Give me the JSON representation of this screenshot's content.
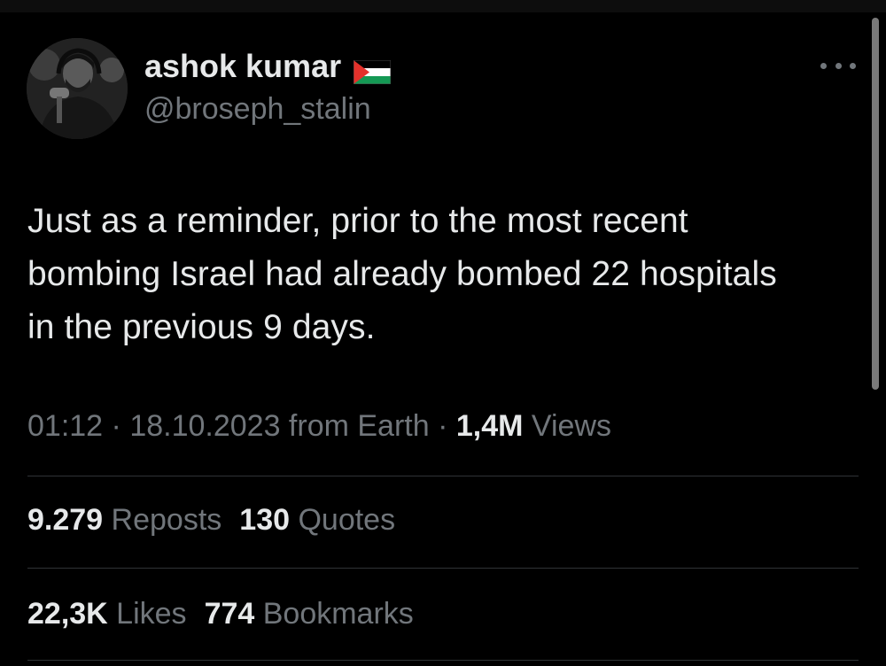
{
  "author": {
    "display_name": "ashok kumar",
    "handle": "@broseph_stalin",
    "flag_icon": "palestine-flag-icon"
  },
  "menu": {
    "icon": "more-horizontal-icon"
  },
  "tweet": {
    "lines": [
      "Just as a reminder, prior to the most recent",
      "bombing Israel had already bombed 22 hospitals",
      "in the previous 9 days."
    ]
  },
  "meta": {
    "time": "01:12",
    "separator1": " · ",
    "date": "18.10.2023",
    "source": " from Earth",
    "separator2": " · ",
    "views_count": "1,4M",
    "views_label": " Views"
  },
  "stats": {
    "reposts_count": "9.279",
    "reposts_label": " Reposts",
    "quotes_count": "130",
    "quotes_label": " Quotes",
    "likes_count": "22,3K",
    "likes_label": " Likes",
    "bookmarks_count": "774",
    "bookmarks_label": " Bookmarks"
  },
  "colors": {
    "background": "#000000",
    "text_primary": "#e7e9ea",
    "text_secondary": "#71767b",
    "divider": "#2f3336"
  }
}
